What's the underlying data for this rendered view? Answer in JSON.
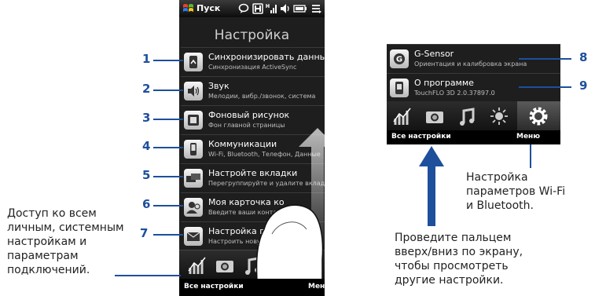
{
  "phone": {
    "status": {
      "start_label": "Пуск"
    },
    "title": "Настройка",
    "rows": [
      {
        "title": "Синхронизировать данные",
        "sub": "Синхронизация ActiveSync"
      },
      {
        "title": "Звук",
        "sub": "Мелодии, вибр./звонок, система"
      },
      {
        "title": "Фоновый рисунок",
        "sub": "Фон главной страницы"
      },
      {
        "title": "Коммуникации",
        "sub": "Wi-Fi, Bluetooth, Телефон, Данные"
      },
      {
        "title": "Настройте вкладки",
        "sub": "Перегруппируйте и удалите вкладки"
      },
      {
        "title": "Моя карточка ко",
        "sub": "Введите ваши конта"
      },
      {
        "title": "Настройка почты",
        "sub": "Настроить новую почту"
      }
    ],
    "softkeys": {
      "left": "Все настройки",
      "right": "Меню"
    }
  },
  "phone2": {
    "rows": [
      {
        "title": "G-Sensor",
        "sub": "Ориентация и калибровка экрана"
      },
      {
        "title": "О программе",
        "sub": "TouchFLO 3D 2.0.37897.0"
      }
    ],
    "softkeys": {
      "left": "Все настройки",
      "right": "Меню"
    }
  },
  "callouts": {
    "numbers": [
      "1",
      "2",
      "3",
      "4",
      "5",
      "6",
      "7",
      "8",
      "9"
    ]
  },
  "notes": {
    "left": [
      "Доступ ко всем",
      "личным, системным",
      "настройкам и",
      "параметрам",
      "подключений."
    ],
    "wifi": [
      "Настройка",
      "параметров Wi-Fi",
      "и Bluetooth."
    ],
    "swipe": [
      "Проведите пальцем",
      "вверх/вниз по экрану,",
      "чтобы просмотреть",
      "другие настройки."
    ]
  },
  "colors": {
    "accent": "#1e4f9c",
    "screen_bg": "#1e1e1e"
  }
}
